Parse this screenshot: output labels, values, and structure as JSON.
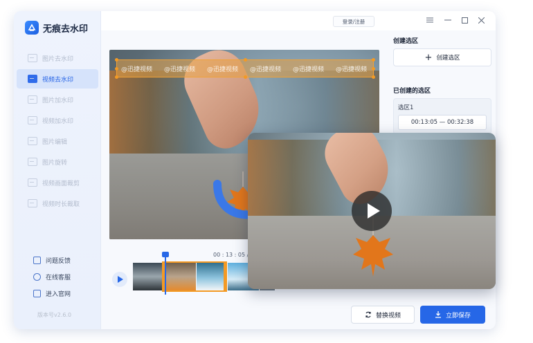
{
  "app": {
    "title": "无痕去水印",
    "version": "版本号v2.6.0"
  },
  "topbar": {
    "login_label": "登录/注册",
    "controls": [
      "menu-icon",
      "minimize-icon",
      "maximize-icon",
      "close-icon"
    ]
  },
  "sidebar": {
    "items": [
      {
        "label": "图片去水印",
        "icon": "image-icon",
        "active": false
      },
      {
        "label": "视频去水印",
        "icon": "video-icon",
        "active": true
      },
      {
        "label": "图片加水印",
        "icon": "image-add-icon",
        "active": false
      },
      {
        "label": "视频加水印",
        "icon": "video-add-icon",
        "active": false
      },
      {
        "label": "图片编辑",
        "icon": "edit-icon",
        "active": false
      },
      {
        "label": "图片旋转",
        "icon": "rotate-icon",
        "active": false
      },
      {
        "label": "视频画面裁剪",
        "icon": "crop-icon",
        "active": false
      },
      {
        "label": "视频时长裁取",
        "icon": "trim-icon",
        "active": false
      }
    ],
    "bottom_links": [
      {
        "label": "问题反馈",
        "icon": "feedback-icon"
      },
      {
        "label": "在线客服",
        "icon": "support-icon"
      },
      {
        "label": "进入官网",
        "icon": "website-icon"
      }
    ]
  },
  "video": {
    "watermark_text": "@迅捷视频",
    "watermark_repeat": 6
  },
  "timeline": {
    "current_time": "00 : 13 : 05 / 00 :"
  },
  "right_panel": {
    "create_title": "创建选区",
    "create_button": "创建选区",
    "created_title": "已创建的选区",
    "regions": [
      {
        "name": "选区1",
        "range": "00:13:05 — 00:32:38"
      }
    ]
  },
  "actions": {
    "replace_label": "替换视频",
    "save_label": "立即保存"
  },
  "colors": {
    "accent": "#2667e7",
    "selection": "#f39a24"
  }
}
